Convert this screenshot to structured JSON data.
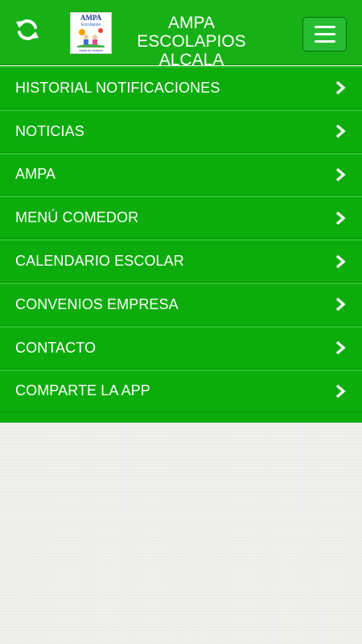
{
  "header": {
    "title_line1": "AMPA ESCOLAPIOS",
    "title_line2": "ALCALA",
    "refresh_icon": "refresh-icon",
    "menu_icon": "hamburger-icon",
    "logo": {
      "title": "AMPA",
      "subtitle": "Escolapios",
      "city": "Alcalá de Henares"
    },
    "accent_color": "#17b017"
  },
  "menu": {
    "items": [
      {
        "label": "HISTORIAL NOTIFICACIONES"
      },
      {
        "label": "NOTICIAS"
      },
      {
        "label": "AMPA"
      },
      {
        "label": "MENÚ COMEDOR"
      },
      {
        "label": "CALENDARIO ESCOLAR"
      },
      {
        "label": "CONVENIOS EMPRESA"
      },
      {
        "label": "CONTACTO"
      },
      {
        "label": "COMPARTE LA APP"
      }
    ],
    "chevron_icon": "chevron-right-icon"
  }
}
